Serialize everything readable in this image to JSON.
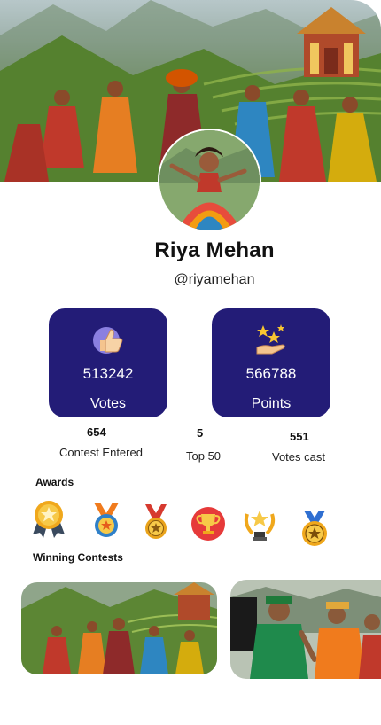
{
  "profile": {
    "name": "Riya Mehan",
    "handle": "@riyamehan"
  },
  "stats_cards": [
    {
      "icon": "thumbs-up-icon",
      "value": "513242",
      "label": "Votes"
    },
    {
      "icon": "stars-hand-icon",
      "value": "566788",
      "label": "Points"
    }
  ],
  "stats": [
    {
      "value": "654",
      "label": "Contest Entered"
    },
    {
      "value": "5",
      "label": "Top 50"
    },
    {
      "value": "551",
      "label": "Votes cast"
    }
  ],
  "sections": {
    "awards": "Awards",
    "winning": "Winning Contests"
  },
  "awards": [
    {
      "icon": "star-medal-icon"
    },
    {
      "icon": "orange-ribbon-medal-icon"
    },
    {
      "icon": "red-ribbon-star-medal-icon"
    },
    {
      "icon": "trophy-badge-icon"
    },
    {
      "icon": "laurel-trophy-icon"
    },
    {
      "icon": "gold-star-medal-icon"
    }
  ],
  "colors": {
    "card_bg": "#231c77",
    "accent_gold": "#f2b51e"
  }
}
